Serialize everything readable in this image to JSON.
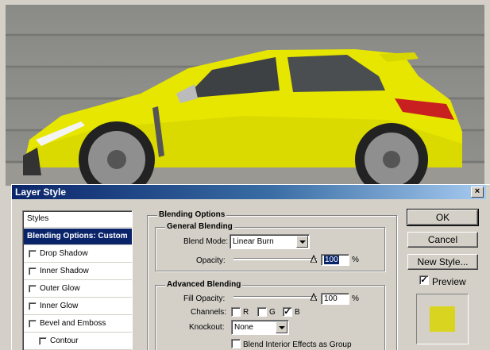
{
  "dialog": {
    "title": "Layer Style",
    "close_glyph": "×"
  },
  "styles_list": {
    "header": "Styles",
    "items": [
      {
        "label": "Blending Options: Custom",
        "selected": true,
        "checkbox": false
      },
      {
        "label": "Drop Shadow",
        "selected": false,
        "checkbox": true,
        "checked": false
      },
      {
        "label": "Inner Shadow",
        "selected": false,
        "checkbox": true,
        "checked": false
      },
      {
        "label": "Outer Glow",
        "selected": false,
        "checkbox": true,
        "checked": false
      },
      {
        "label": "Inner Glow",
        "selected": false,
        "checkbox": true,
        "checked": false
      },
      {
        "label": "Bevel and Emboss",
        "selected": false,
        "checkbox": true,
        "checked": false
      },
      {
        "label": "Contour",
        "selected": false,
        "checkbox": true,
        "checked": false
      }
    ]
  },
  "blending": {
    "section_title": "Blending Options",
    "general": {
      "title": "General Blending",
      "blend_mode_label": "Blend Mode:",
      "blend_mode_value": "Linear Burn",
      "opacity_label": "Opacity:",
      "opacity_value": "100",
      "opacity_unit": "%",
      "opacity_level": 100
    },
    "advanced": {
      "title": "Advanced Blending",
      "fill_opacity_label": "Fill Opacity:",
      "fill_opacity_value": "100",
      "fill_opacity_unit": "%",
      "fill_opacity_level": 100,
      "channels_label": "Channels:",
      "channels": [
        {
          "label": "R",
          "checked": false
        },
        {
          "label": "G",
          "checked": false
        },
        {
          "label": "B",
          "checked": true
        }
      ],
      "knockout_label": "Knockout:",
      "knockout_value": "None",
      "blend_interior_label": "Blend Interior Effects as Group",
      "blend_interior_checked": false
    }
  },
  "buttons": {
    "ok": "OK",
    "cancel": "Cancel",
    "new_style": "New Style...",
    "preview_label": "Preview",
    "preview_checked": true
  },
  "colors": {
    "car_body": "#e6e600",
    "preview_swatch": "#d9d420",
    "titlebar_start": "#0a246a",
    "titlebar_end": "#a6caf0"
  }
}
